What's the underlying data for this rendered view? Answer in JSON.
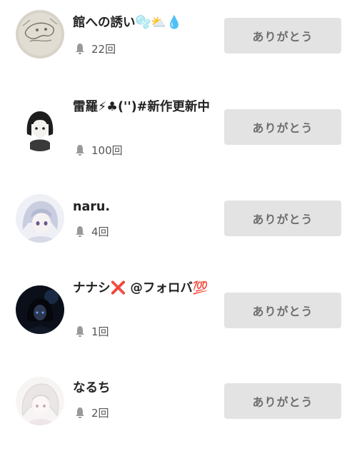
{
  "users": [
    {
      "name": "館への誘い🫧⛅💧",
      "count": "22回",
      "thank_label": "ありがとう",
      "avatar": "sketch"
    },
    {
      "name": "雷羅⚡♣('')#新作更新中",
      "count": "100回",
      "thank_label": "ありがとう",
      "avatar": "dark-hair"
    },
    {
      "name": "naru.",
      "count": "4回",
      "thank_label": "ありがとう",
      "avatar": "silver-hair"
    },
    {
      "name": "ナナシ❌ @フォロバ💯",
      "count": "1回",
      "thank_label": "ありがとう",
      "avatar": "night"
    },
    {
      "name": "なるち",
      "count": "2回",
      "thank_label": "ありがとう",
      "avatar": "white-hair"
    }
  ]
}
